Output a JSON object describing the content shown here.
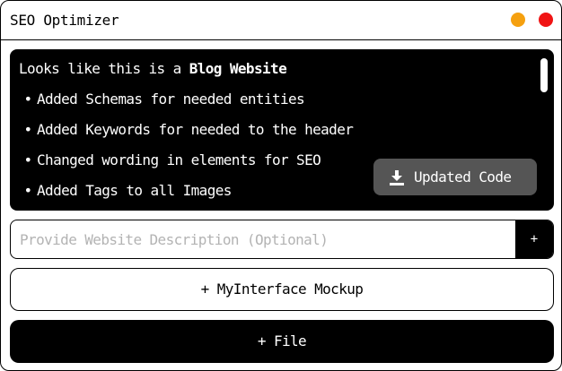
{
  "window": {
    "title": "SEO Optimizer",
    "minimize_color": "#f5a00f",
    "close_color": "#f01414"
  },
  "output": {
    "intro_prefix": "Looks like this is a ",
    "intro_bold": "Blog Website",
    "bullet_glyph": "•",
    "items": [
      "Added Schemas for needed entities",
      "Added Keywords for needed to the header",
      "Changed wording in elements for SEO",
      "Added Tags to all Images"
    ],
    "updated_code_label": "Updated Code",
    "updated_code_icon": "download-icon"
  },
  "description": {
    "value": "",
    "placeholder": "Provide Website Description (Optional)",
    "add_label": "+"
  },
  "mockup_button_label": "+ MyInterface Mockup",
  "file_button_label": "+ File"
}
